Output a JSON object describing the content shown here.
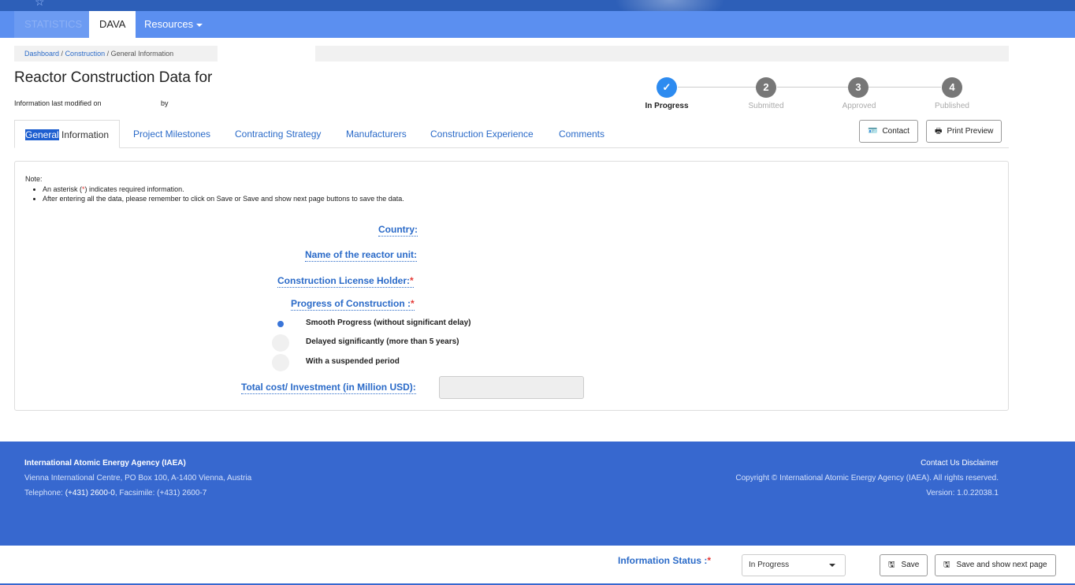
{
  "nav": {
    "statistics": "STATISTICS",
    "dava": "DAVA",
    "resources": "Resources"
  },
  "breadcrumb": {
    "dashboard": "Dashboard",
    "construction": "Construction",
    "current": "General Information"
  },
  "page": {
    "title": "Reactor Construction Data for",
    "modified_label": "Information last modified on",
    "by_label": "by"
  },
  "stepper": {
    "steps": [
      {
        "number": "✓",
        "label": "In Progress",
        "active": true
      },
      {
        "number": "2",
        "label": "Submitted",
        "active": false
      },
      {
        "number": "3",
        "label": "Approved",
        "active": false
      },
      {
        "number": "4",
        "label": "Published",
        "active": false
      }
    ]
  },
  "tabs": {
    "general_highlight": "General",
    "general_rest": " Information",
    "milestones": "Project Milestones",
    "contracting": "Contracting Strategy",
    "manufacturers": "Manufacturers",
    "experience": "Construction Experience",
    "comments": "Comments"
  },
  "actions": {
    "contact": "Contact",
    "print_preview": "Print Preview"
  },
  "note": {
    "title": "Note:",
    "line1_pre": "An asterisk (",
    "line1_star": "*",
    "line1_post": ") indicates required information.",
    "line2": "After entering all the data, please remember to click on Save or Save and show next page buttons to save the data."
  },
  "form": {
    "country": "Country:",
    "reactor_name": "Name of the reactor unit:",
    "license_holder": "Construction License Holder:",
    "progress": "Progress of Construction :",
    "required_mark": "*",
    "progress_options": [
      {
        "label": "Smooth Progress (without significant delay)",
        "checked": true
      },
      {
        "label": "Delayed significantly (more than 5 years)",
        "checked": false
      },
      {
        "label": "With a suspended period",
        "checked": false
      }
    ],
    "total_cost": "Total cost/ Investment (in Million USD):",
    "total_cost_value": ""
  },
  "footer": {
    "org": "International Atomic Energy Agency (IAEA)",
    "address": "Vienna International Centre, PO Box 100, A-1400 Vienna, Austria",
    "tel_label": "Telephone: ",
    "tel": "(+431) 2600-0",
    "fax": ", Facsimile: (+431) 2600-7",
    "links": "Contact Us Disclaimer",
    "copyright": "Copyright © International Atomic Energy Agency (IAEA). All rights reserved.",
    "version": "Version: 1.0.22038.1"
  },
  "bottom": {
    "status_label": "Information Status :",
    "status_value": "In Progress",
    "save": "Save",
    "save_next": "Save and show next page"
  },
  "colors": {
    "nav": "#5b8ff0",
    "footer": "#3768cf",
    "link": "#2a6ac8",
    "step_active": "#2d8bf0",
    "required": "#e53935"
  }
}
